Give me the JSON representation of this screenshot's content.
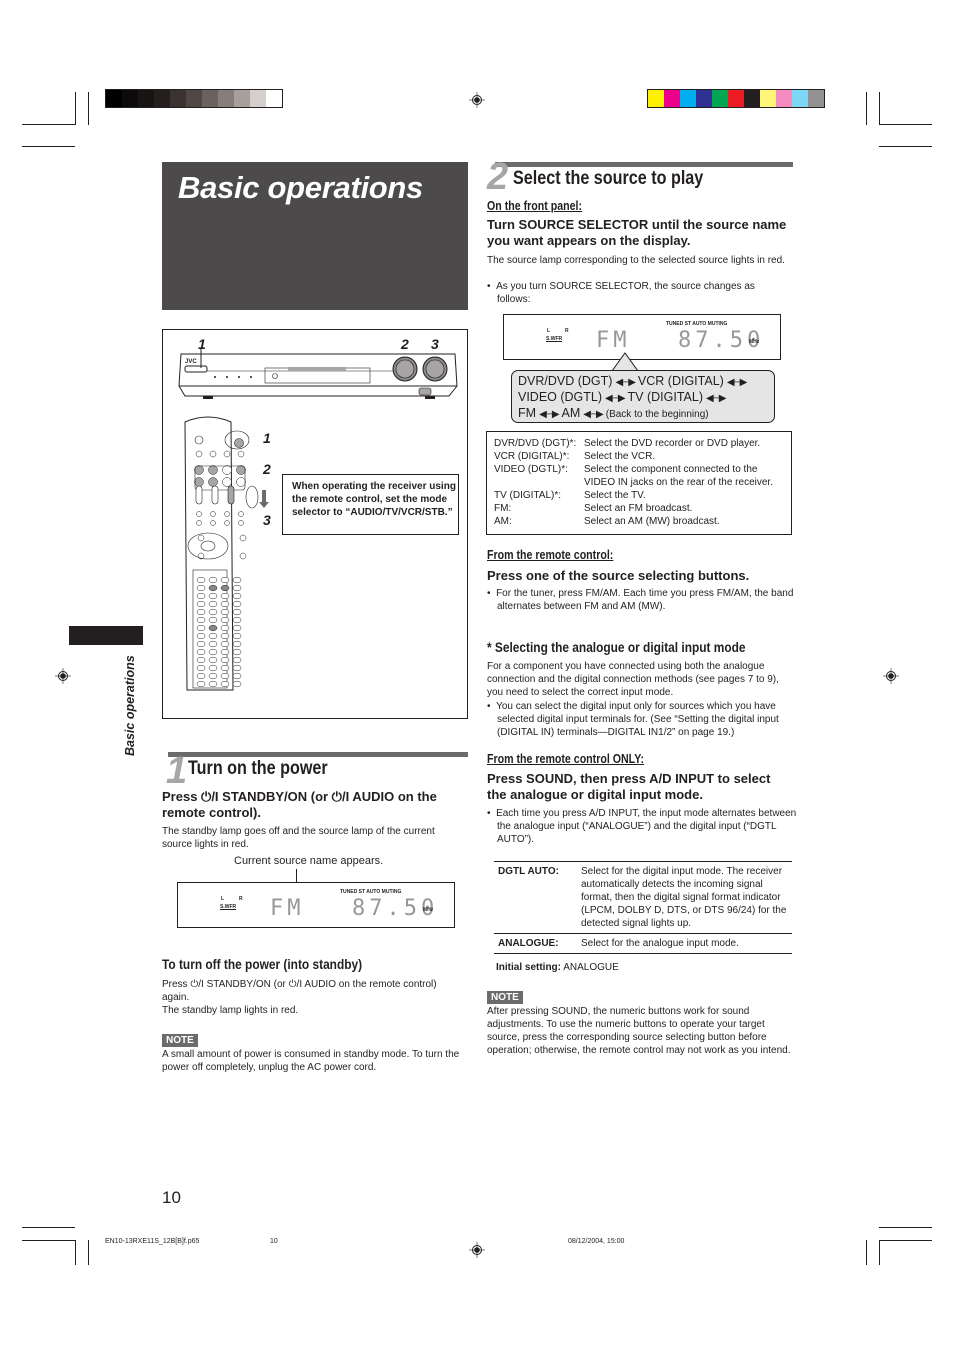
{
  "print_marks": {
    "gray_swatches": [
      "#000000",
      "#0c0a0a",
      "#181413",
      "#231f1d",
      "#3a3331",
      "#514845",
      "#6b625f",
      "#877e7b",
      "#a79f9c",
      "#d5cfcd",
      "#ffffff"
    ],
    "color_swatches": [
      "#fff200",
      "#ec008c",
      "#00aeef",
      "#2e3192",
      "#00a651",
      "#ed1c24",
      "#231f20",
      "#fff679",
      "#f58ac0",
      "#7dd8f7",
      "#939191"
    ]
  },
  "header": {
    "title": "Basic operations"
  },
  "side_tab": {
    "label": "Basic operations"
  },
  "illustration": {
    "brand": "JVC",
    "front_panel_numbers": [
      "1",
      "2",
      "3"
    ],
    "remote_numbers": [
      "1",
      "2",
      "3"
    ],
    "callout": "When operating the receiver using the remote control, set the mode selector to “AUDIO/TV/VCR/STB.”"
  },
  "step1": {
    "number": "1",
    "title": "Turn on the power",
    "instruction": "Press ⏻/I STANDBY/ON (or ⏻/I AUDIO on the remote control).",
    "body": "The standby lamp goes off and the source lamp of the current source lights in red.",
    "display_caption": "Current source name appears.",
    "display": {
      "source": "FM",
      "freq": "87.50",
      "unit": "MHz",
      "indicators": "TUNED  ST  AUTO MUTING",
      "ch_l": "L",
      "ch_r": "R",
      "swfr": "S.WFR"
    },
    "standby_heading": "To turn off the power (into standby)",
    "standby_body_1": "Press ⏻/I STANDBY/ON (or ⏻/I AUDIO on the remote control) again.",
    "standby_body_2": "The standby lamp lights in red.",
    "note_label": "NOTE",
    "note": "A small amount of power is consumed in standby mode. To turn the power off completely, unplug the AC power cord."
  },
  "step2": {
    "number": "2",
    "title": "Select the source to play",
    "front_panel_heading": "On the front panel:",
    "front_panel_instruction": "Turn SOURCE SELECTOR until the source name you want appears on the display.",
    "front_panel_body": "The source lamp corresponding to the selected source lights in red.",
    "front_panel_bullet": "As you turn SOURCE SELECTOR, the source changes as follows:",
    "display": {
      "source": "FM",
      "freq": "87.50",
      "unit": "MHz",
      "indicators": "TUNED  ST  AUTO MUTING",
      "ch_l": "L",
      "ch_r": "R",
      "swfr": "S.WFR"
    },
    "cycle": {
      "s1": "DVR/DVD (DGT)",
      "s2": "VCR (DIGITAL)",
      "s3": "VIDEO (DGTL)",
      "s4": "TV (DIGITAL)",
      "s5": "FM",
      "s6": "AM",
      "back": "(Back to the beginning)",
      "arrow": "◀─▶"
    },
    "sources": [
      {
        "key": "DVR/DVD (DGT)*:",
        "desc": "Select the DVD recorder or DVD player."
      },
      {
        "key": "VCR (DIGITAL)*:",
        "desc": "Select the VCR."
      },
      {
        "key": "VIDEO (DGTL)*:",
        "desc": "Select the component connected to the VIDEO IN jacks on the rear of the receiver."
      },
      {
        "key": "TV (DIGITAL)*:",
        "desc": "Select the TV."
      },
      {
        "key": "FM:",
        "desc": "Select an FM broadcast."
      },
      {
        "key": "AM:",
        "desc": "Select an AM (MW) broadcast."
      }
    ],
    "remote_heading": "From the remote control:",
    "remote_instruction": "Press one of the source selecting buttons.",
    "remote_bullet": "For the tuner, press FM/AM. Each time you press FM/AM, the band alternates between FM and AM (MW).",
    "input_mode_heading": "* Selecting the analogue or digital input mode",
    "input_mode_body": "For a component you have connected using both the analogue connection and the digital connection methods (see pages 7 to 9), you need to select the correct input mode.",
    "input_mode_bullet": "You can select the digital input only for sources which you have selected digital input terminals for. (See “Setting the digital input (DIGITAL IN) terminals—DIGITAL IN1/2” on page 19.)",
    "remote_only_heading": "From the remote control ONLY:",
    "remote_only_instruction": "Press SOUND, then press A/D INPUT to select the analogue or digital input mode.",
    "remote_only_bullet": "Each time you press A/D INPUT, the input mode alternates between the analogue input (“ANALOGUE”) and the digital input (“DGTL AUTO”).",
    "modes": [
      {
        "key": "DGTL AUTO:",
        "desc": "Select for the digital input mode. The receiver automatically detects the incoming signal format, then the digital signal format indicator (LPCM, DOLBY D, DTS, or DTS 96/24) for the detected signal lights up."
      },
      {
        "key": "ANALOGUE:",
        "desc": "Select for the analogue input mode."
      }
    ],
    "initial_label": "Initial setting:",
    "initial_value": "ANALOGUE",
    "note_label": "NOTE",
    "note": "After pressing SOUND, the numeric buttons work for sound adjustments. To use the numeric buttons to operate your target source, press the corresponding source selecting button before operation; otherwise, the remote control may not work as you intend."
  },
  "footer": {
    "page_number": "10",
    "file": "EN10-13RXE11S_12B[B]f.p65",
    "file_page": "10",
    "datetime": "08/12/2004, 15:00"
  }
}
